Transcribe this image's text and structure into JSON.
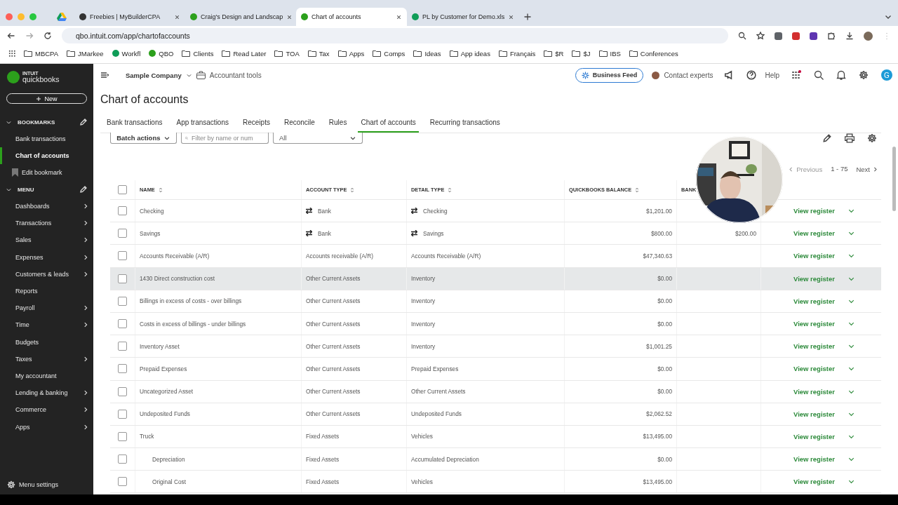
{
  "browser": {
    "tabs": [
      {
        "kind": "drive",
        "selected": false
      },
      {
        "title": "Freebies | MyBuilderCPA",
        "kind": "site",
        "selected": false
      },
      {
        "title": "Craig's Design and Landscap",
        "kind": "qb",
        "selected": false
      },
      {
        "title": "Chart of accounts",
        "kind": "qb",
        "selected": true
      },
      {
        "title": "PL by Customer for Demo.xls",
        "kind": "sheet",
        "selected": false
      }
    ],
    "url": "qbo.intuit.com/app/chartofaccounts",
    "bookmarks": [
      {
        "label": "MBCPA",
        "kind": "folder"
      },
      {
        "label": "JMarkee",
        "kind": "folder"
      },
      {
        "label": "Workfl",
        "kind": "sheet"
      },
      {
        "label": "QBO",
        "kind": "qb"
      },
      {
        "label": "Clients",
        "kind": "folder"
      },
      {
        "label": "Read Later",
        "kind": "folder"
      },
      {
        "label": "TOA",
        "kind": "folder"
      },
      {
        "label": "Tax",
        "kind": "folder"
      },
      {
        "label": "Apps",
        "kind": "folder"
      },
      {
        "label": "Comps",
        "kind": "folder"
      },
      {
        "label": "Ideas",
        "kind": "folder"
      },
      {
        "label": "App ideas",
        "kind": "folder"
      },
      {
        "label": "Français",
        "kind": "folder"
      },
      {
        "label": "$R",
        "kind": "folder"
      },
      {
        "label": "$J",
        "kind": "folder"
      },
      {
        "label": "IBS",
        "kind": "folder"
      },
      {
        "label": "Conferences",
        "kind": "folder"
      }
    ]
  },
  "sidebar": {
    "brand_top": "INTUIT",
    "brand": "quickbooks",
    "new_button": "New",
    "bookmarks_heading": "BOOKMARKS",
    "bookmarks": [
      {
        "label": "Bank transactions",
        "selected": false
      },
      {
        "label": "Chart of accounts",
        "selected": true
      }
    ],
    "edit_bookmark": "Edit bookmark",
    "menu_heading": "MENU",
    "menu": [
      {
        "label": "Dashboards",
        "has_submenu": true
      },
      {
        "label": "Transactions",
        "has_submenu": true
      },
      {
        "label": "Sales",
        "has_submenu": true
      },
      {
        "label": "Expenses",
        "has_submenu": true
      },
      {
        "label": "Customers & leads",
        "has_submenu": true
      },
      {
        "label": "Reports",
        "has_submenu": false
      },
      {
        "label": "Payroll",
        "has_submenu": true
      },
      {
        "label": "Time",
        "has_submenu": true
      },
      {
        "label": "Budgets",
        "has_submenu": false
      },
      {
        "label": "Taxes",
        "has_submenu": true
      },
      {
        "label": "My accountant",
        "has_submenu": false
      },
      {
        "label": "Lending & banking",
        "has_submenu": true
      },
      {
        "label": "Commerce",
        "has_submenu": true
      },
      {
        "label": "Apps",
        "has_submenu": true
      }
    ],
    "menu_settings": "Menu settings"
  },
  "topbar": {
    "company": "Sample Company",
    "accountant_tools": "Accountant tools",
    "business_feed": "Business Feed",
    "contact_experts": "Contact experts",
    "help": "Help",
    "user_initial": "G"
  },
  "page": {
    "title": "Chart of accounts",
    "tabs": [
      {
        "label": "Bank transactions",
        "selected": false
      },
      {
        "label": "App transactions",
        "selected": false
      },
      {
        "label": "Receipts",
        "selected": false
      },
      {
        "label": "Reconcile",
        "selected": false
      },
      {
        "label": "Rules",
        "selected": false
      },
      {
        "label": "Chart of accounts",
        "selected": true
      },
      {
        "label": "Recurring transactions",
        "selected": false
      }
    ],
    "batch_actions": "Batch actions",
    "filter": {
      "placeholder": "Filter by name or num"
    },
    "type_filter": "All",
    "pagination": {
      "previous": "Previous",
      "previous_disabled": true,
      "range": "1 - 75",
      "next": "Next"
    }
  },
  "table": {
    "select_all_checked": false,
    "columns": [
      "NAME",
      "ACCOUNT TYPE",
      "DETAIL TYPE",
      "QUICKBOOKS BALANCE",
      "BANK"
    ],
    "rows": [
      {
        "name": "Checking",
        "account_type": "Bank",
        "detail_type": "Checking",
        "balance": "$1,201.00",
        "bank_icon": true,
        "checked": false,
        "hovered": false,
        "action": "View register"
      },
      {
        "name": "Savings",
        "account_type": "Bank",
        "detail_type": "Savings",
        "balance": "$800.00",
        "bank_balance": "$200.00",
        "bank_icon": true,
        "checked": false,
        "hovered": false,
        "action": "View register"
      },
      {
        "name": "Accounts Receivable (A/R)",
        "account_type": "Accounts receivable (A/R)",
        "detail_type": "Accounts Receivable (A/R)",
        "balance": "$47,340.63",
        "bank_icon": false,
        "checked": false,
        "hovered": false,
        "action": "View register"
      },
      {
        "name": "1430 Direct construction cost",
        "account_type": "Other Current Assets",
        "detail_type": "Inventory",
        "balance": "$0.00",
        "bank_icon": false,
        "checked": false,
        "hovered": true,
        "action": "View register"
      },
      {
        "name": "Billings in excess of costs - over billings",
        "account_type": "Other Current Assets",
        "detail_type": "Inventory",
        "balance": "$0.00",
        "bank_icon": false,
        "checked": false,
        "hovered": false,
        "action": "View register"
      },
      {
        "name": "Costs in excess of billings - under billings",
        "account_type": "Other Current Assets",
        "detail_type": "Inventory",
        "balance": "$0.00",
        "bank_icon": false,
        "checked": false,
        "hovered": false,
        "action": "View register"
      },
      {
        "name": "Inventory Asset",
        "account_type": "Other Current Assets",
        "detail_type": "Inventory",
        "balance": "$1,001.25",
        "bank_icon": false,
        "checked": false,
        "hovered": false,
        "action": "View register"
      },
      {
        "name": "Prepaid Expenses",
        "account_type": "Other Current Assets",
        "detail_type": "Prepaid Expenses",
        "balance": "$0.00",
        "bank_icon": false,
        "checked": false,
        "hovered": false,
        "action": "View register"
      },
      {
        "name": "Uncategorized Asset",
        "account_type": "Other Current Assets",
        "detail_type": "Other Current Assets",
        "balance": "$0.00",
        "bank_icon": false,
        "checked": false,
        "hovered": false,
        "action": "View register"
      },
      {
        "name": "Undeposited Funds",
        "account_type": "Other Current Assets",
        "detail_type": "Undeposited Funds",
        "balance": "$2,062.52",
        "bank_icon": false,
        "checked": false,
        "hovered": false,
        "action": "View register"
      },
      {
        "name": "Truck",
        "account_type": "Fixed Assets",
        "detail_type": "Vehicles",
        "balance": "$13,495.00",
        "bank_icon": false,
        "checked": false,
        "hovered": false,
        "action": "View register",
        "children": [
          {
            "name": "Depreciation",
            "account_type": "Fixed Assets",
            "detail_type": "Accumulated Depreciation",
            "balance": "$0.00",
            "bank_icon": false,
            "checked": false,
            "hovered": false,
            "action": "View register"
          },
          {
            "name": "Original Cost",
            "account_type": "Fixed Assets",
            "detail_type": "Vehicles",
            "balance": "$13,495.00",
            "bank_icon": false,
            "checked": false,
            "hovered": false,
            "action": "View register"
          }
        ]
      }
    ]
  }
}
